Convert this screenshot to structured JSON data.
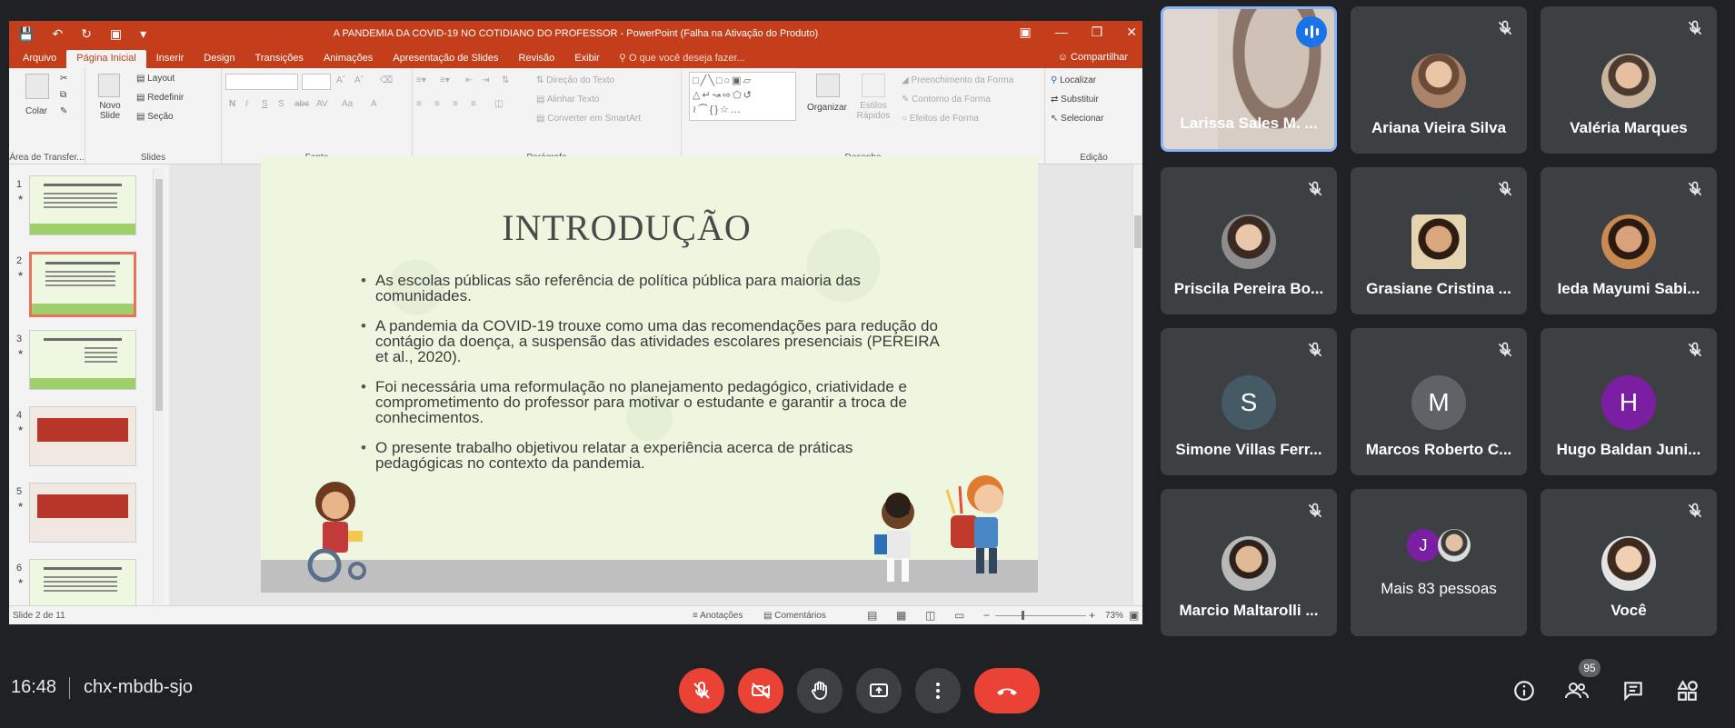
{
  "powerpoint": {
    "window_title": "A PANDEMIA DA COVID-19 NO COTIDIANO DO PROFESSOR - PowerPoint (Falha na Ativação do Produto)",
    "tabs": [
      "Arquivo",
      "Página Inicial",
      "Inserir",
      "Design",
      "Transições",
      "Animações",
      "Apresentação de Slides",
      "Revisão",
      "Exibir"
    ],
    "active_tab": "Página Inicial",
    "tell_me": "O que você deseja fazer...",
    "share": "Compartilhar",
    "ribbon": {
      "clipboard": {
        "paste": "Colar",
        "label": "Área de Transfer..."
      },
      "slides": {
        "new_slide": "Novo Slide",
        "layout": "Layout",
        "reset": "Redefinir",
        "section": "Seção",
        "label": "Slides"
      },
      "font": {
        "label": "Fonte",
        "bold": "N",
        "italic": "I",
        "underline": "S",
        "shadow": "S",
        "strike": "abc",
        "spacing": "AV",
        "case": "Aa",
        "color": "A"
      },
      "paragraph": {
        "label": "Parágrafo",
        "text_direction": "Direção do Texto",
        "align_text": "Alinhar Texto",
        "smartart": "Converter em SmartArt"
      },
      "drawing": {
        "label": "Desenho",
        "arrange": "Organizar",
        "quick_styles": "Estilos Rápidos",
        "fill": "Preenchimento da Forma",
        "outline": "Contorno da Forma",
        "effects": "Efeitos de Forma"
      },
      "editing": {
        "label": "Edição",
        "find": "Localizar",
        "replace": "Substituir",
        "select": "Selecionar"
      }
    },
    "thumbnails": [
      {
        "num": "1"
      },
      {
        "num": "2"
      },
      {
        "num": "3"
      },
      {
        "num": "4"
      },
      {
        "num": "5"
      },
      {
        "num": "6"
      }
    ],
    "selected_slide": 2,
    "slide": {
      "title": "INTRODUÇÃO",
      "bullets": [
        "As escolas públicas são referência de política pública para maioria das comunidades.",
        "A pandemia da COVID-19 trouxe como uma das recomendações para redução do contágio da doença, a suspensão das atividades escolares presenciais (PEREIRA et al., 2020).",
        "Foi necessária uma reformulação no planejamento pedagógico, criatividade e comprometimento do professor para motivar o estudante e garantir a troca de conhecimentos.",
        "O presente trabalho objetivou relatar a experiência acerca de práticas pedagógicas no contexto da pandemia."
      ]
    },
    "status": {
      "slide_info": "Slide 2 de 11",
      "notes": "Anotações",
      "comments": "Comentários",
      "zoom": "73%",
      "zoom_level": 0.73
    }
  },
  "participants": [
    {
      "name": "Larissa Sales M. ...",
      "speaking": true
    },
    {
      "name": "Ariana Vieira Silva",
      "muted": true
    },
    {
      "name": "Valéria Marques",
      "muted": true
    },
    {
      "name": "Priscila Pereira Bo...",
      "muted": true
    },
    {
      "name": "Grasiane Cristina ...",
      "muted": true
    },
    {
      "name": "Ieda Mayumi Sabi...",
      "muted": true
    },
    {
      "name": "Simone Villas Ferr...",
      "initial": "S",
      "color": "#455a64",
      "muted": true
    },
    {
      "name": "Marcos Roberto C...",
      "initial": "M",
      "color": "#5f6368",
      "muted": true
    },
    {
      "name": "Hugo Baldan Juni...",
      "initial": "H",
      "color": "#7b1fa2",
      "muted": true
    },
    {
      "name": "Marcio Maltarolli ...",
      "muted": true
    },
    {
      "name": "Mais 83 pessoas",
      "initial": "J",
      "color": "#7b1fa2"
    },
    {
      "name": "Você",
      "muted": true
    }
  ],
  "meeting": {
    "time": "16:48",
    "code": "chx-mbdb-sjo",
    "participant_count": "95"
  },
  "colors": {
    "ppt_accent": "#c43e1c",
    "meet_bg": "#202124",
    "tile_bg": "#3c4043",
    "danger": "#ea4335",
    "speaking": "#1a73e8"
  }
}
